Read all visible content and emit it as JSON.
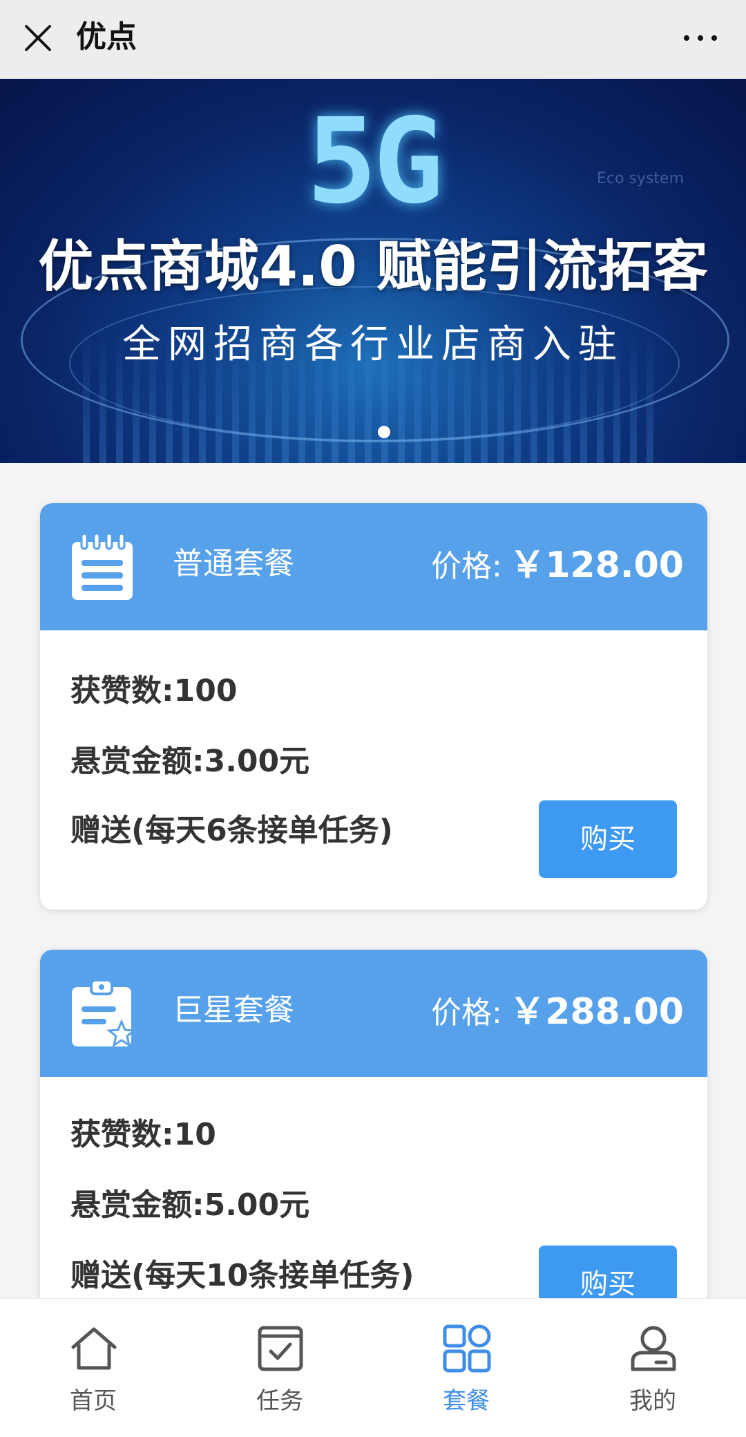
{
  "app": {
    "title": "优点"
  },
  "banner": {
    "logo_text": "5G",
    "eco_text": "Eco system",
    "headline": "优点商城4.0 赋能引流拓客",
    "subline": "全网招商各行业店商入驻"
  },
  "packages": [
    {
      "name": "普通套餐",
      "price_label": "价格:",
      "price": "￥128.00",
      "likes": "获赞数:100",
      "reward": "悬赏金额:3.00元",
      "bonus": "赠送(每天6条接单任务)",
      "buy_label": "购买",
      "icon": "notepad-icon"
    },
    {
      "name": "巨星套餐",
      "price_label": "价格:",
      "price": "￥288.00",
      "likes": "获赞数:10",
      "reward": "悬赏金额:5.00元",
      "bonus": "赠送(每天10条接单任务)",
      "buy_label": "购买",
      "icon": "clipboard-star-icon"
    }
  ],
  "tabbar": {
    "items": [
      {
        "label": "首页",
        "icon": "home-icon",
        "active": false
      },
      {
        "label": "任务",
        "icon": "task-check-icon",
        "active": false
      },
      {
        "label": "套餐",
        "icon": "grid-icon",
        "active": true
      },
      {
        "label": "我的",
        "icon": "user-icon",
        "active": false
      }
    ]
  },
  "colors": {
    "accent": "#57a1eb",
    "button": "#3e99f0",
    "active_tab": "#3e8ee8"
  }
}
